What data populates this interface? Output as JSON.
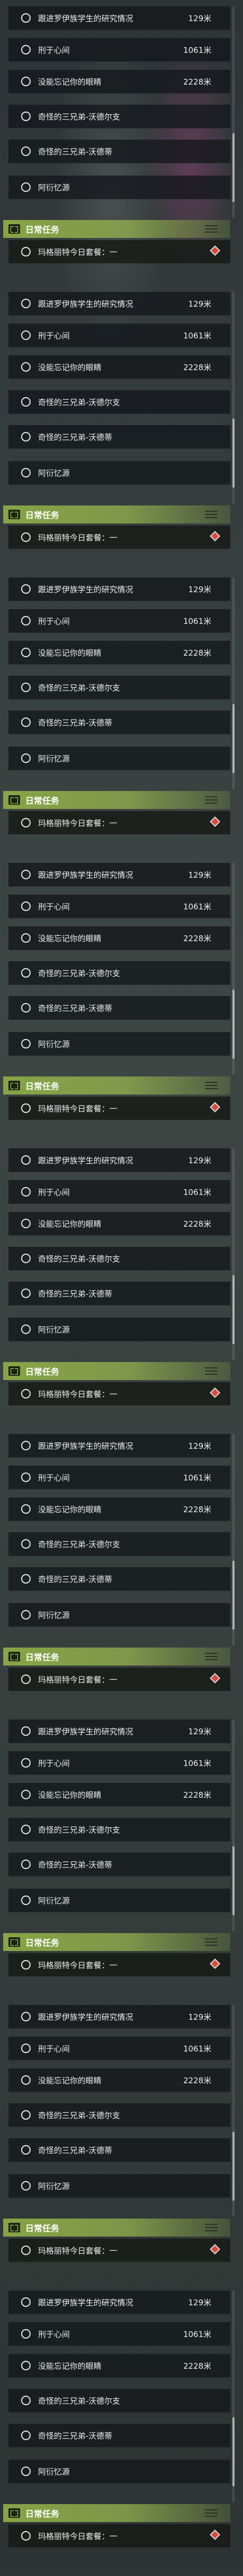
{
  "quests": [
    {
      "name": "跟进罗伊族学生的研究情况",
      "distance": "129米"
    },
    {
      "name": "刑于心间",
      "distance": "1061米"
    },
    {
      "name": "没能忘记你的眼睛",
      "distance": "2228米"
    },
    {
      "name": "奇怪的三兄弟-沃德尔支",
      "distance": ""
    },
    {
      "name": "奇怪的三兄弟-沃德蒂",
      "distance": ""
    },
    {
      "name": "阿衍忆源",
      "distance": ""
    }
  ],
  "daily": {
    "title": "日常任务",
    "task": "玛格丽特今日套餐：一"
  },
  "colors": {
    "accent": "#8cab46",
    "marker": "#d94a3c"
  },
  "icons": {
    "row": "circle-icon",
    "header": "book-icon",
    "menu": "menu-icon",
    "marker": "diamond-marker-icon"
  }
}
